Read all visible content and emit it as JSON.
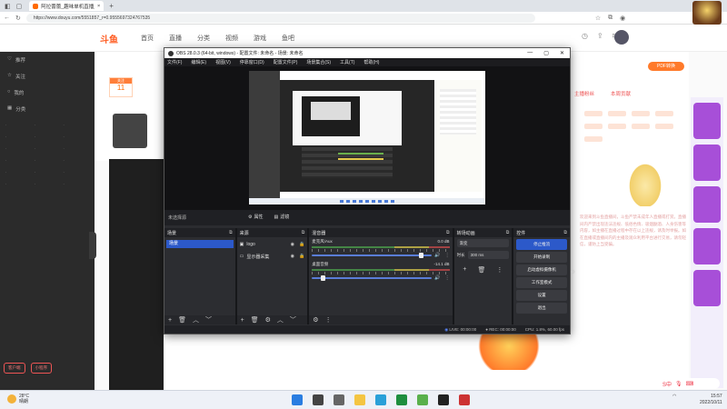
{
  "browser": {
    "tab_title": "阿拉蕾蕾_趣味单机直播_斗鱼...",
    "url": "https://www.douyu.com/5551857_r=0.9555697324767535"
  },
  "site": {
    "logo": "斗鱼",
    "nav": [
      "首页",
      "直播",
      "分类",
      "视频",
      "游戏",
      "鱼吧"
    ],
    "follow_count": "11",
    "follow_tag": "关注",
    "pdf_button": "PDF转换",
    "right_tabs": [
      "主播粉丝",
      "本周贡献"
    ],
    "right_text": "欢迎来到斗鱼直播间，斗鱼严禁未成年人直播或打赏。直播间内严禁出现违法违规、低俗色情、吸烟酗酒、人身伤害等内容，如主播在直播过程中存在以上违规，请及时举报。如在直播或直播间内的主播及观众利用平台进行交易，请勿轻信，谨防上当受骗。",
    "left_items": [
      "推荐",
      "关注",
      "我的",
      "分类"
    ],
    "left_buttons": [
      "客户端",
      "小程序"
    ],
    "gift_label": "开运礼包"
  },
  "obs": {
    "title": "OBS 28.0.3 (64-bit, windows) - 配置文件: 未命名 - 场景: 未命名",
    "menu": [
      "文件(F)",
      "编辑(E)",
      "视图(V)",
      "停靠窗口(D)",
      "配置文件(P)",
      "场景集合(S)",
      "工具(T)",
      "帮助(H)"
    ],
    "no_source": "未选择源",
    "props_btn": "属性",
    "filters_btn": "滤镜",
    "docks": {
      "scenes": {
        "title": "场景",
        "items": [
          "场景"
        ]
      },
      "sources": {
        "title": "来源",
        "items": [
          "logo",
          "显示器采集"
        ]
      },
      "mixer": {
        "title": "混音器",
        "channels": [
          {
            "name": "麦克风/Aux",
            "db": "0.0 dB",
            "level": 0.92
          },
          {
            "name": "桌面音频",
            "db": "-14.1 dB",
            "level": 0.1
          }
        ]
      },
      "transitions": {
        "title": "转场动画",
        "type": "渐变",
        "duration_label": "时长",
        "duration": "300 ms"
      },
      "controls": {
        "title": "控件",
        "buttons": [
          "停止推流",
          "开始录制",
          "启动虚拟摄像机",
          "工作室模式",
          "设置",
          "退出"
        ]
      }
    },
    "status": {
      "live": "LIVE: 00:00:00",
      "rec": "REC: 00:00:00",
      "cpu": "CPU: 1.8%, 60.00 fps"
    }
  },
  "taskbar": {
    "weather_temp": "28°C",
    "weather_desc": "晴朗",
    "time": "15:57",
    "date": "2022/10/11",
    "ime": "S中"
  }
}
